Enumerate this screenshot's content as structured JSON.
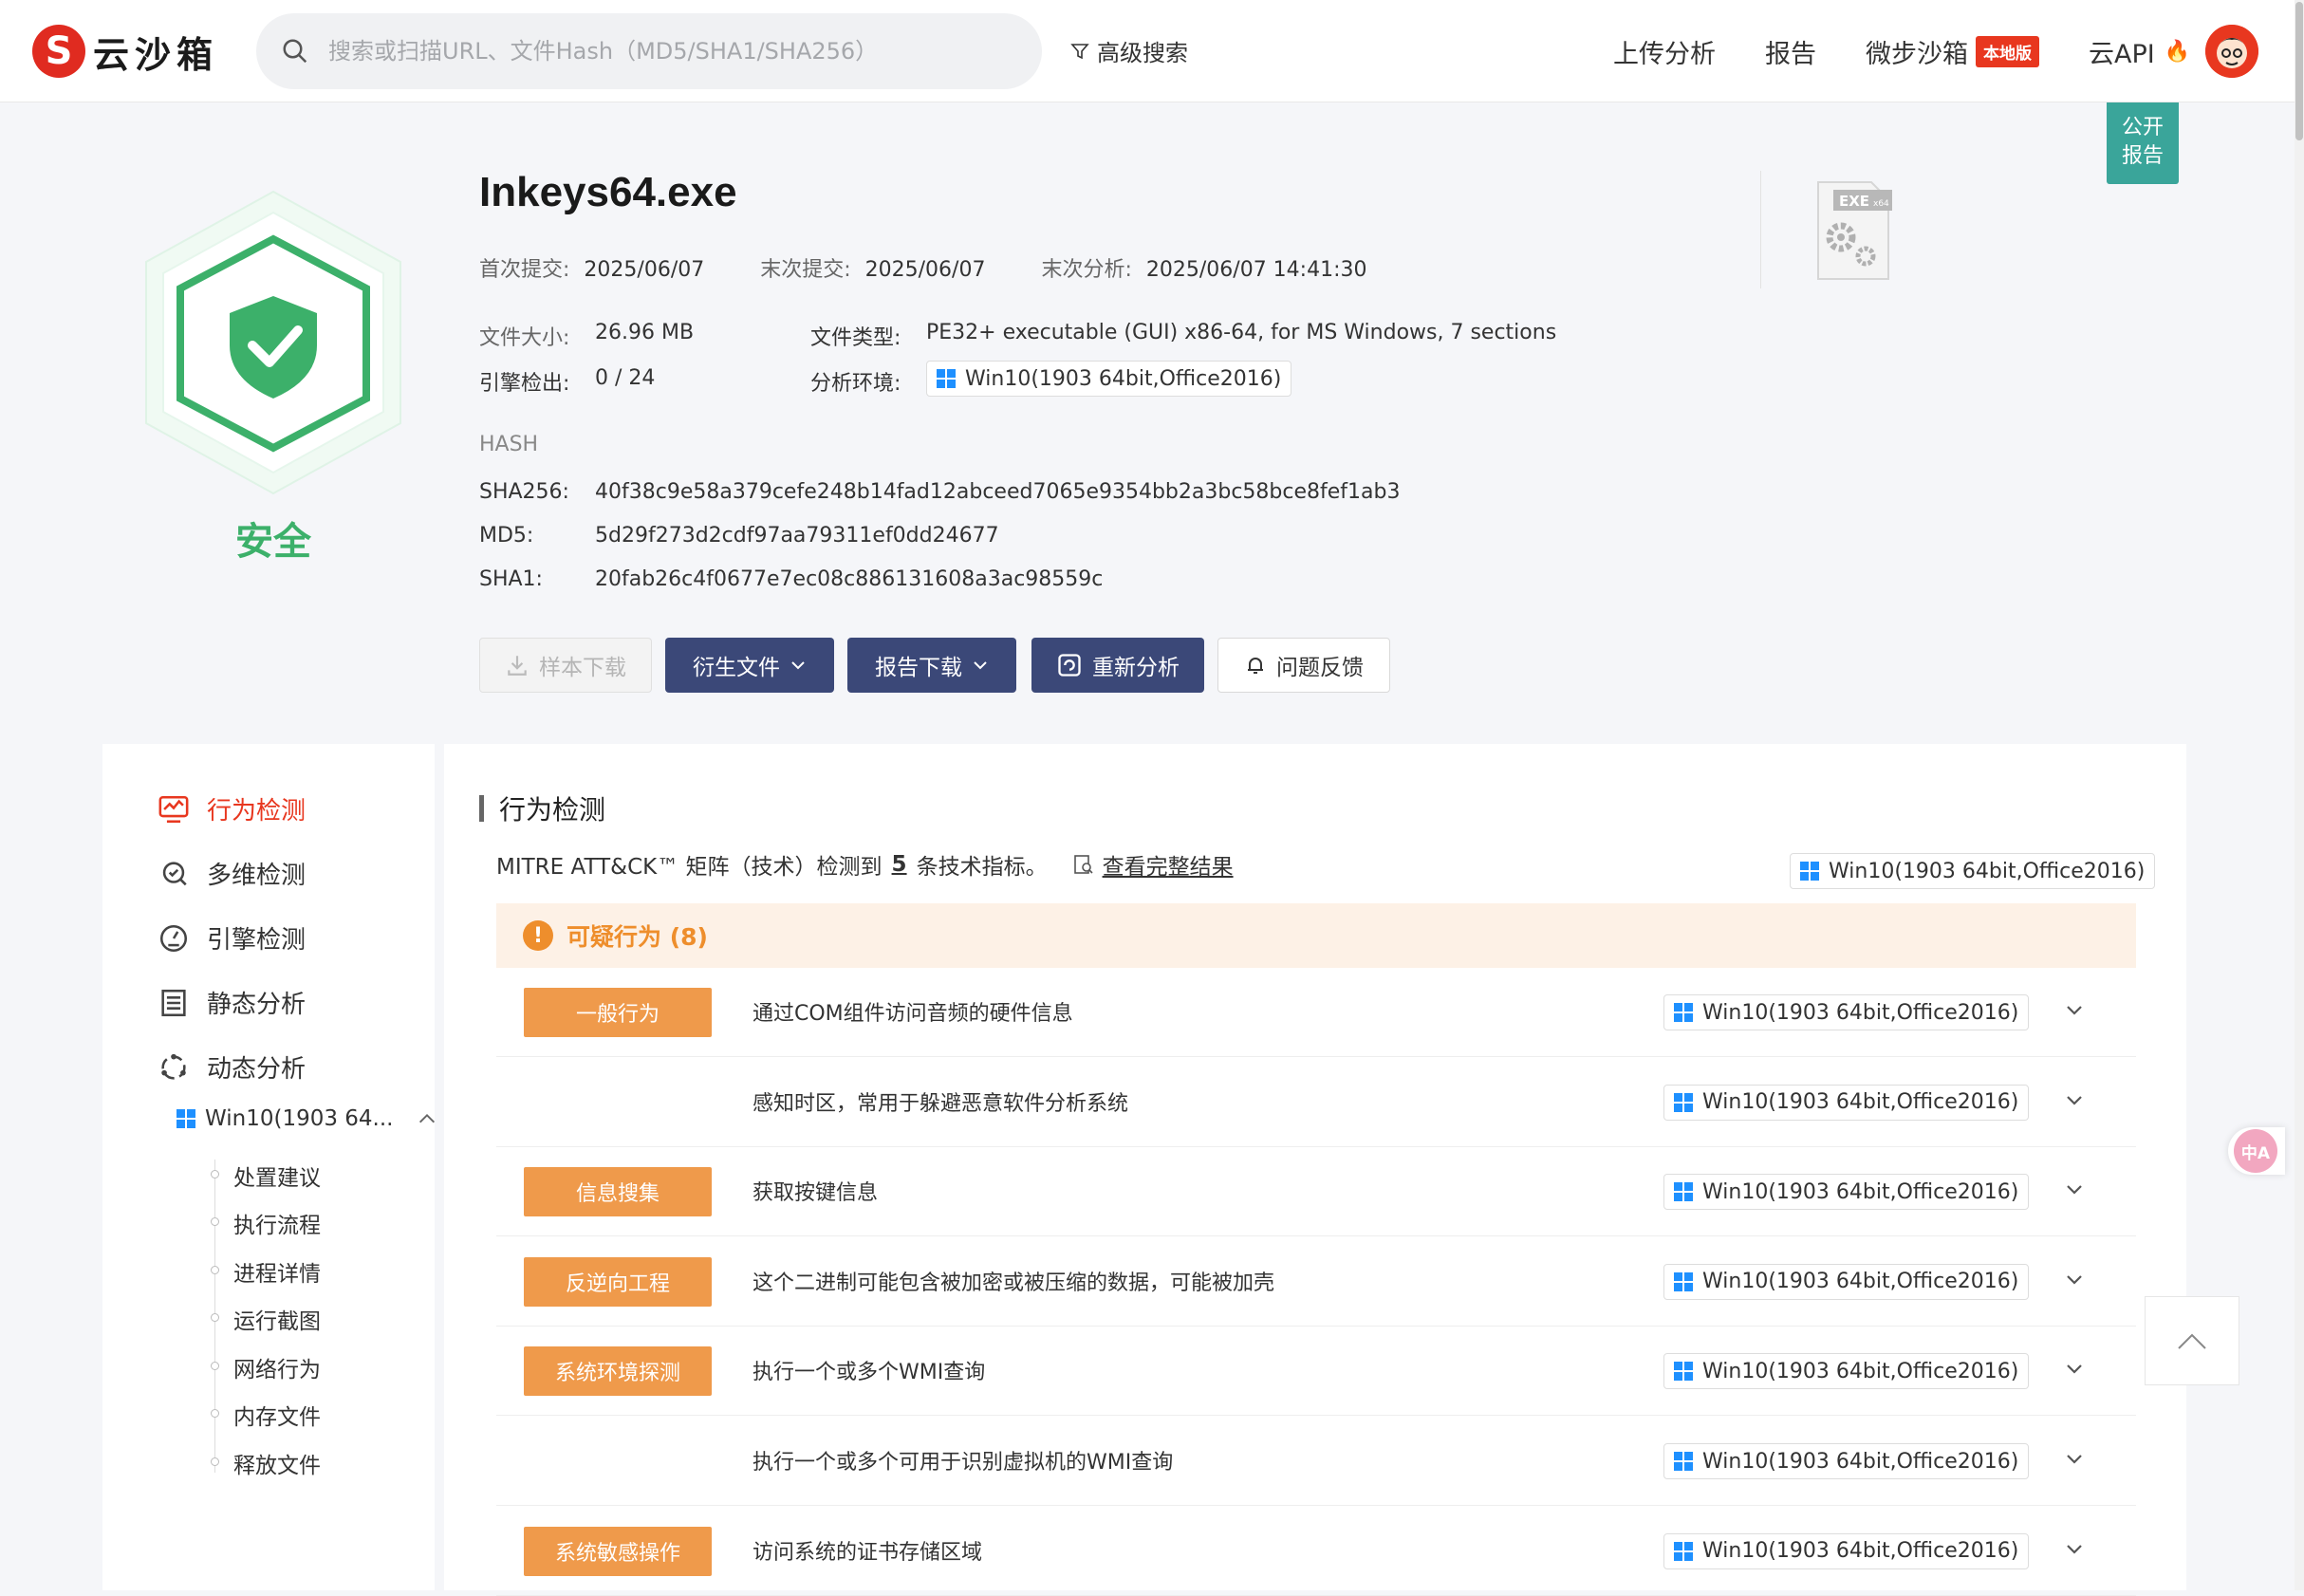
{
  "nav": {
    "logo_letter": "S",
    "logo_text": "云沙箱",
    "search_placeholder": "搜索或扫描URL、文件Hash（MD5/SHA1/SHA256）",
    "advanced_search": "高级搜索",
    "links": {
      "upload": "上传分析",
      "report": "报告",
      "micro_sandbox": "微步沙箱",
      "local_badge": "本地版",
      "cloud_api": "云API"
    }
  },
  "public_report": {
    "line1": "公开",
    "line2": "报告"
  },
  "file": {
    "verdict": "安全",
    "name": "Inkeys64.exe",
    "first_submit_label": "首次提交:",
    "first_submit": "2025/06/07",
    "last_submit_label": "末次提交:",
    "last_submit": "2025/06/07",
    "last_analysis_label": "末次分析:",
    "last_analysis": "2025/06/07 14:41:30",
    "size_label": "文件大小:",
    "size": "26.96 MB",
    "type_label": "文件类型:",
    "type": "PE32+ executable (GUI) x86-64, for MS Windows, 7 sections",
    "engine_label": "引擎检出:",
    "engine": "0 / 24",
    "env_label": "分析环境:",
    "env": "Win10(1903 64bit,Office2016)",
    "exe_icon_text": "EXE",
    "exe_icon_sub": "x64"
  },
  "hash": {
    "heading": "HASH",
    "sha256_label": "SHA256:",
    "sha256": "40f38c9e58a379cefe248b14fad12abceed7065e9354bb2a3bc58bce8fef1ab3",
    "md5_label": "MD5:",
    "md5": "5d29f273d2cdf97aa79311ef0dd24677",
    "sha1_label": "SHA1:",
    "sha1": "20fab26c4f0677e7ec08c886131608a3ac98559c"
  },
  "actions": {
    "download_sample": "样本下载",
    "derived_files": "衍生文件",
    "report_download": "报告下载",
    "reanalyze": "重新分析",
    "feedback": "问题反馈"
  },
  "sidebar": {
    "items": [
      {
        "label": "行为检测",
        "icon": "monitor-chart-icon"
      },
      {
        "label": "多维检测",
        "icon": "scan-search-icon"
      },
      {
        "label": "引擎检测",
        "icon": "engine-gauge-icon"
      },
      {
        "label": "静态分析",
        "icon": "list-doc-icon"
      },
      {
        "label": "动态分析",
        "icon": "cycle-nodes-icon"
      }
    ],
    "env_node": "Win10(1903 64...",
    "sub_items": [
      "处置建议",
      "执行流程",
      "进程详情",
      "运行截图",
      "网络行为",
      "内存文件",
      "释放文件"
    ]
  },
  "main": {
    "section_title": "行为检测",
    "mitre_prefix": "MITRE ATT&CK™ 矩阵（技术）检测到",
    "mitre_count": "5",
    "mitre_suffix": "条技术指标。",
    "view_full": "查看完整结果",
    "env_filter": "Win10(1903 64bit,Office2016)",
    "suspicious_label": "可疑行为 (8)",
    "rows": [
      {
        "tag": "一般行为",
        "text": "通过COM组件访问音频的硬件信息",
        "env": "Win10(1903 64bit,Office2016)"
      },
      {
        "tag": "",
        "text": "感知时区，常用于躲避恶意软件分析系统",
        "env": "Win10(1903 64bit,Office2016)"
      },
      {
        "tag": "信息搜集",
        "text": "获取按键信息",
        "env": "Win10(1903 64bit,Office2016)"
      },
      {
        "tag": "反逆向工程",
        "text": "这个二进制可能包含被加密或被压缩的数据，可能被加壳",
        "env": "Win10(1903 64bit,Office2016)"
      },
      {
        "tag": "系统环境探测",
        "text": "执行一个或多个WMI查询",
        "env": "Win10(1903 64bit,Office2016)"
      },
      {
        "tag": "",
        "text": "执行一个或多个可用于识别虚拟机的WMI查询",
        "env": "Win10(1903 64bit,Office2016)"
      },
      {
        "tag": "系统敏感操作",
        "text": "访问系统的证书存储区域",
        "env": "Win10(1903 64bit,Office2016)"
      }
    ]
  },
  "float_badge_text": "中A",
  "colors": {
    "accent_dark": "#3b4878",
    "safe_green": "#3cb06a",
    "warn_orange": "#ee8e2c",
    "brand_red": "#e02b20"
  }
}
